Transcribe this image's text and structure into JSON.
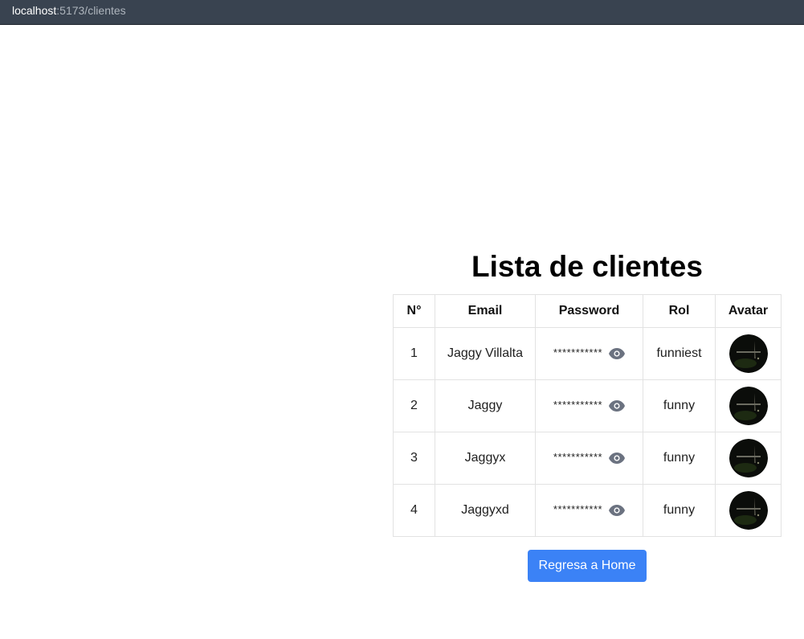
{
  "browser": {
    "url_host": "localhost",
    "url_path": ":5173/clientes"
  },
  "page": {
    "title": "Lista de clientes",
    "home_button_label": "Regresa a Home"
  },
  "table": {
    "headers": {
      "n": "N°",
      "email": "Email",
      "password": "Password",
      "rol": "Rol",
      "avatar": "Avatar"
    },
    "rows": [
      {
        "n": "1",
        "email": "Jaggy Villalta",
        "password": "***********",
        "rol": "funniest"
      },
      {
        "n": "2",
        "email": "Jaggy",
        "password": "***********",
        "rol": "funny"
      },
      {
        "n": "3",
        "email": "Jaggyx",
        "password": "***********",
        "rol": "funny"
      },
      {
        "n": "4",
        "email": "Jaggyxd",
        "password": "***********",
        "rol": "funny"
      }
    ]
  },
  "icons": {
    "toggle_password": "eye-icon",
    "avatar": "avatar-image"
  },
  "colors": {
    "button": "#3b82f6",
    "url_bar": "#394350",
    "eye_icon": "#6b7280"
  }
}
